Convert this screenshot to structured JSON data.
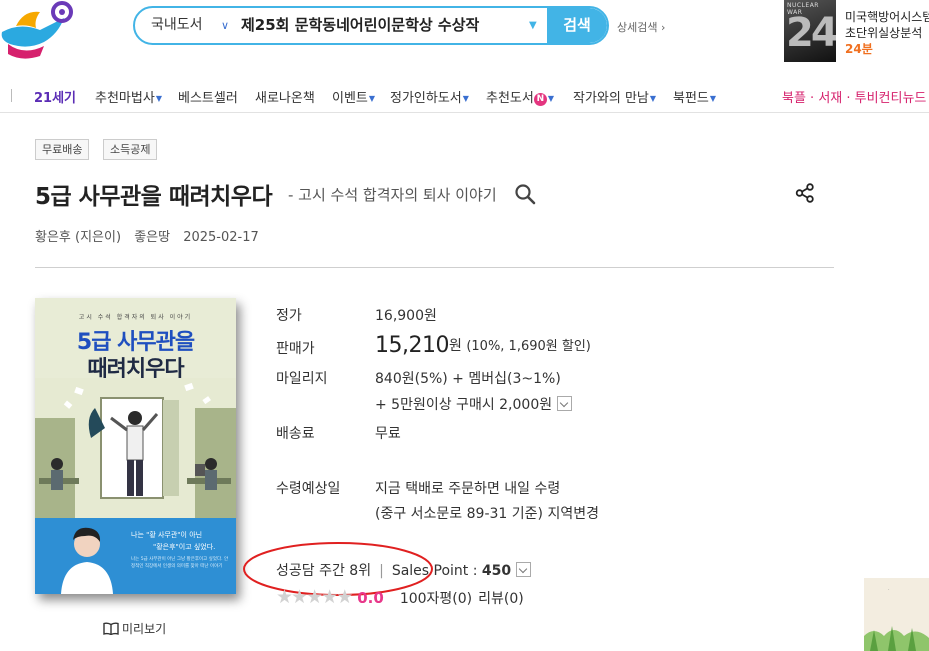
{
  "header": {
    "search": {
      "scope": "국내도서",
      "query": "제25회 문학동네어린이문학상 수상작",
      "button_label": "검색"
    },
    "detail_search_label": "상세검색 ›",
    "promo": {
      "thumb_title": "NUCLEAR WAR",
      "thumb_number": "24",
      "line1": "미국핵방어시스템",
      "line2": "초단위실상분석",
      "line3": "24분"
    }
  },
  "category_nav": {
    "items": [
      "21세기",
      "추천마법사",
      "베스트셀러",
      "새로나온책",
      "이벤트",
      "정가인하도서",
      "추천도서",
      "작가와의 만남",
      "북펀드"
    ],
    "new_badge": "N",
    "right_links": "북플 · 서재 · 투비컨티뉴드"
  },
  "tags": [
    "무료배송",
    "소득공제"
  ],
  "book": {
    "title": "5급 사무관을 때려치우다",
    "subtitle": "- 고시 수석 합격자의 퇴사 이야기",
    "author": "황은후 (지은이)",
    "publisher": "좋은땅",
    "date": "2025-02-17"
  },
  "cover": {
    "small_text": "고시 수석 합격자의 퇴사 이야기",
    "title_line1": "5급 사무관을",
    "title_line2": "때려치우다",
    "band_line1": "나는 \"황 사무관\"이 아닌",
    "band_line2": "\"황은후\"이고 싶었다.",
    "band_small": "나는 5급 사무관이 아닌 그냥 황은후이고 싶었다. 안정적인 직장에서 인생의 의미를 찾아 떠난 이야기"
  },
  "preview_label": "미리보기",
  "price": {
    "list_label": "정가",
    "list_value": "16,900원",
    "sale_label": "판매가",
    "sale_value": "15,210",
    "sale_unit": "원",
    "sale_discount": "(10%, 1,690원 할인)",
    "mileage_label": "마일리지",
    "mileage_value": "840원(5%) + 멤버십(3~1%)",
    "mileage_extra": "+ 5만원이상 구매시 2,000원",
    "shipping_label": "배송료",
    "shipping_value": "무료",
    "delivery_label": "수령예상일",
    "delivery_line1": "지금 택배로 주문하면 내일 수령",
    "delivery_line2": "(중구 서소문로 89-31 기준) 지역변경"
  },
  "rank": {
    "weekly": "성공담 주간 8위",
    "separator": "|",
    "sales_point_label": "Sales Point :",
    "sales_point_value": "450"
  },
  "rating": {
    "stars": 0,
    "score": "0.0",
    "short_reviews": "100자평(0)",
    "reviews": "리뷰(0)"
  },
  "colors": {
    "accent_blue": "#42b4e6",
    "purple": "#5b2db5",
    "pink": "#d6216d",
    "rating_pink": "#e8388a",
    "annotation_red": "#e02020"
  }
}
